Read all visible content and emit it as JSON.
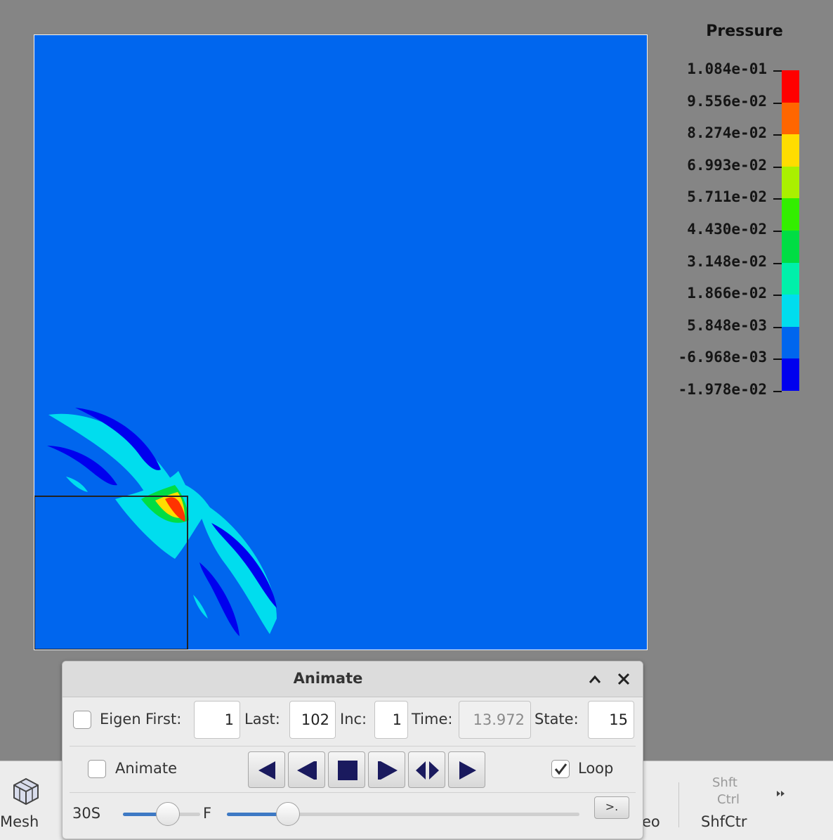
{
  "legend": {
    "title": "Pressure",
    "labels": [
      "1.084e-01",
      "9.556e-02",
      "8.274e-02",
      "6.993e-02",
      "5.711e-02",
      "4.430e-02",
      "3.148e-02",
      "1.866e-02",
      "5.848e-03",
      "-6.968e-03",
      "-1.978e-02"
    ],
    "colors": [
      "#ff0000",
      "#ff6600",
      "#ffdd00",
      "#aaf000",
      "#33ee00",
      "#00dd44",
      "#00f0aa",
      "#00ddee",
      "#0066ee",
      "#0000ee"
    ]
  },
  "toolbar": {
    "mesh_label": "Mesh",
    "shft_ctrl_top": "Shft",
    "shft_ctrl_mid": "Ctrl",
    "shfctr_label": "ShfCtr",
    "partial_label": "eo"
  },
  "animate_panel": {
    "title": "Animate",
    "eigen_label": "Eigen",
    "first_label": "First:",
    "first_value": "1",
    "last_label": "Last:",
    "last_value": "102",
    "inc_label": "Inc:",
    "inc_value": "1",
    "time_label": "Time:",
    "time_value": "13.972",
    "state_label": "State:",
    "state_value": "15",
    "animate_label": "Animate",
    "loop_label": "Loop",
    "loop_checked": true,
    "speed_slow_label": "30S",
    "speed_fast_label": "F",
    "speed_fraction": 0.62,
    "state_fraction": 0.15,
    "step_button_label": ">."
  }
}
